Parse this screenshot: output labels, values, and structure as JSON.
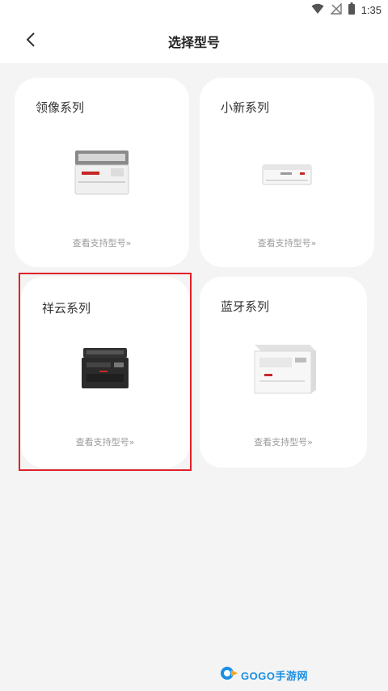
{
  "status_bar": {
    "time": "1:35"
  },
  "header": {
    "title": "选择型号"
  },
  "cards": [
    {
      "title": "领像系列",
      "link": "查看支持型号»"
    },
    {
      "title": "小新系列",
      "link": "查看支持型号»"
    },
    {
      "title": "祥云系列",
      "link": "查看支持型号»"
    },
    {
      "title": "蓝牙系列",
      "link": "查看支持型号»"
    }
  ],
  "watermark": {
    "text": "GOGO手游网"
  },
  "colors": {
    "highlight": "#e0212a",
    "background": "#f4f4f4",
    "card": "#ffffff",
    "link": "#9a9a9a"
  },
  "icons": [
    "wifi-icon",
    "no-signal-icon",
    "battery-icon",
    "back-arrow-icon",
    "logo-icon"
  ]
}
